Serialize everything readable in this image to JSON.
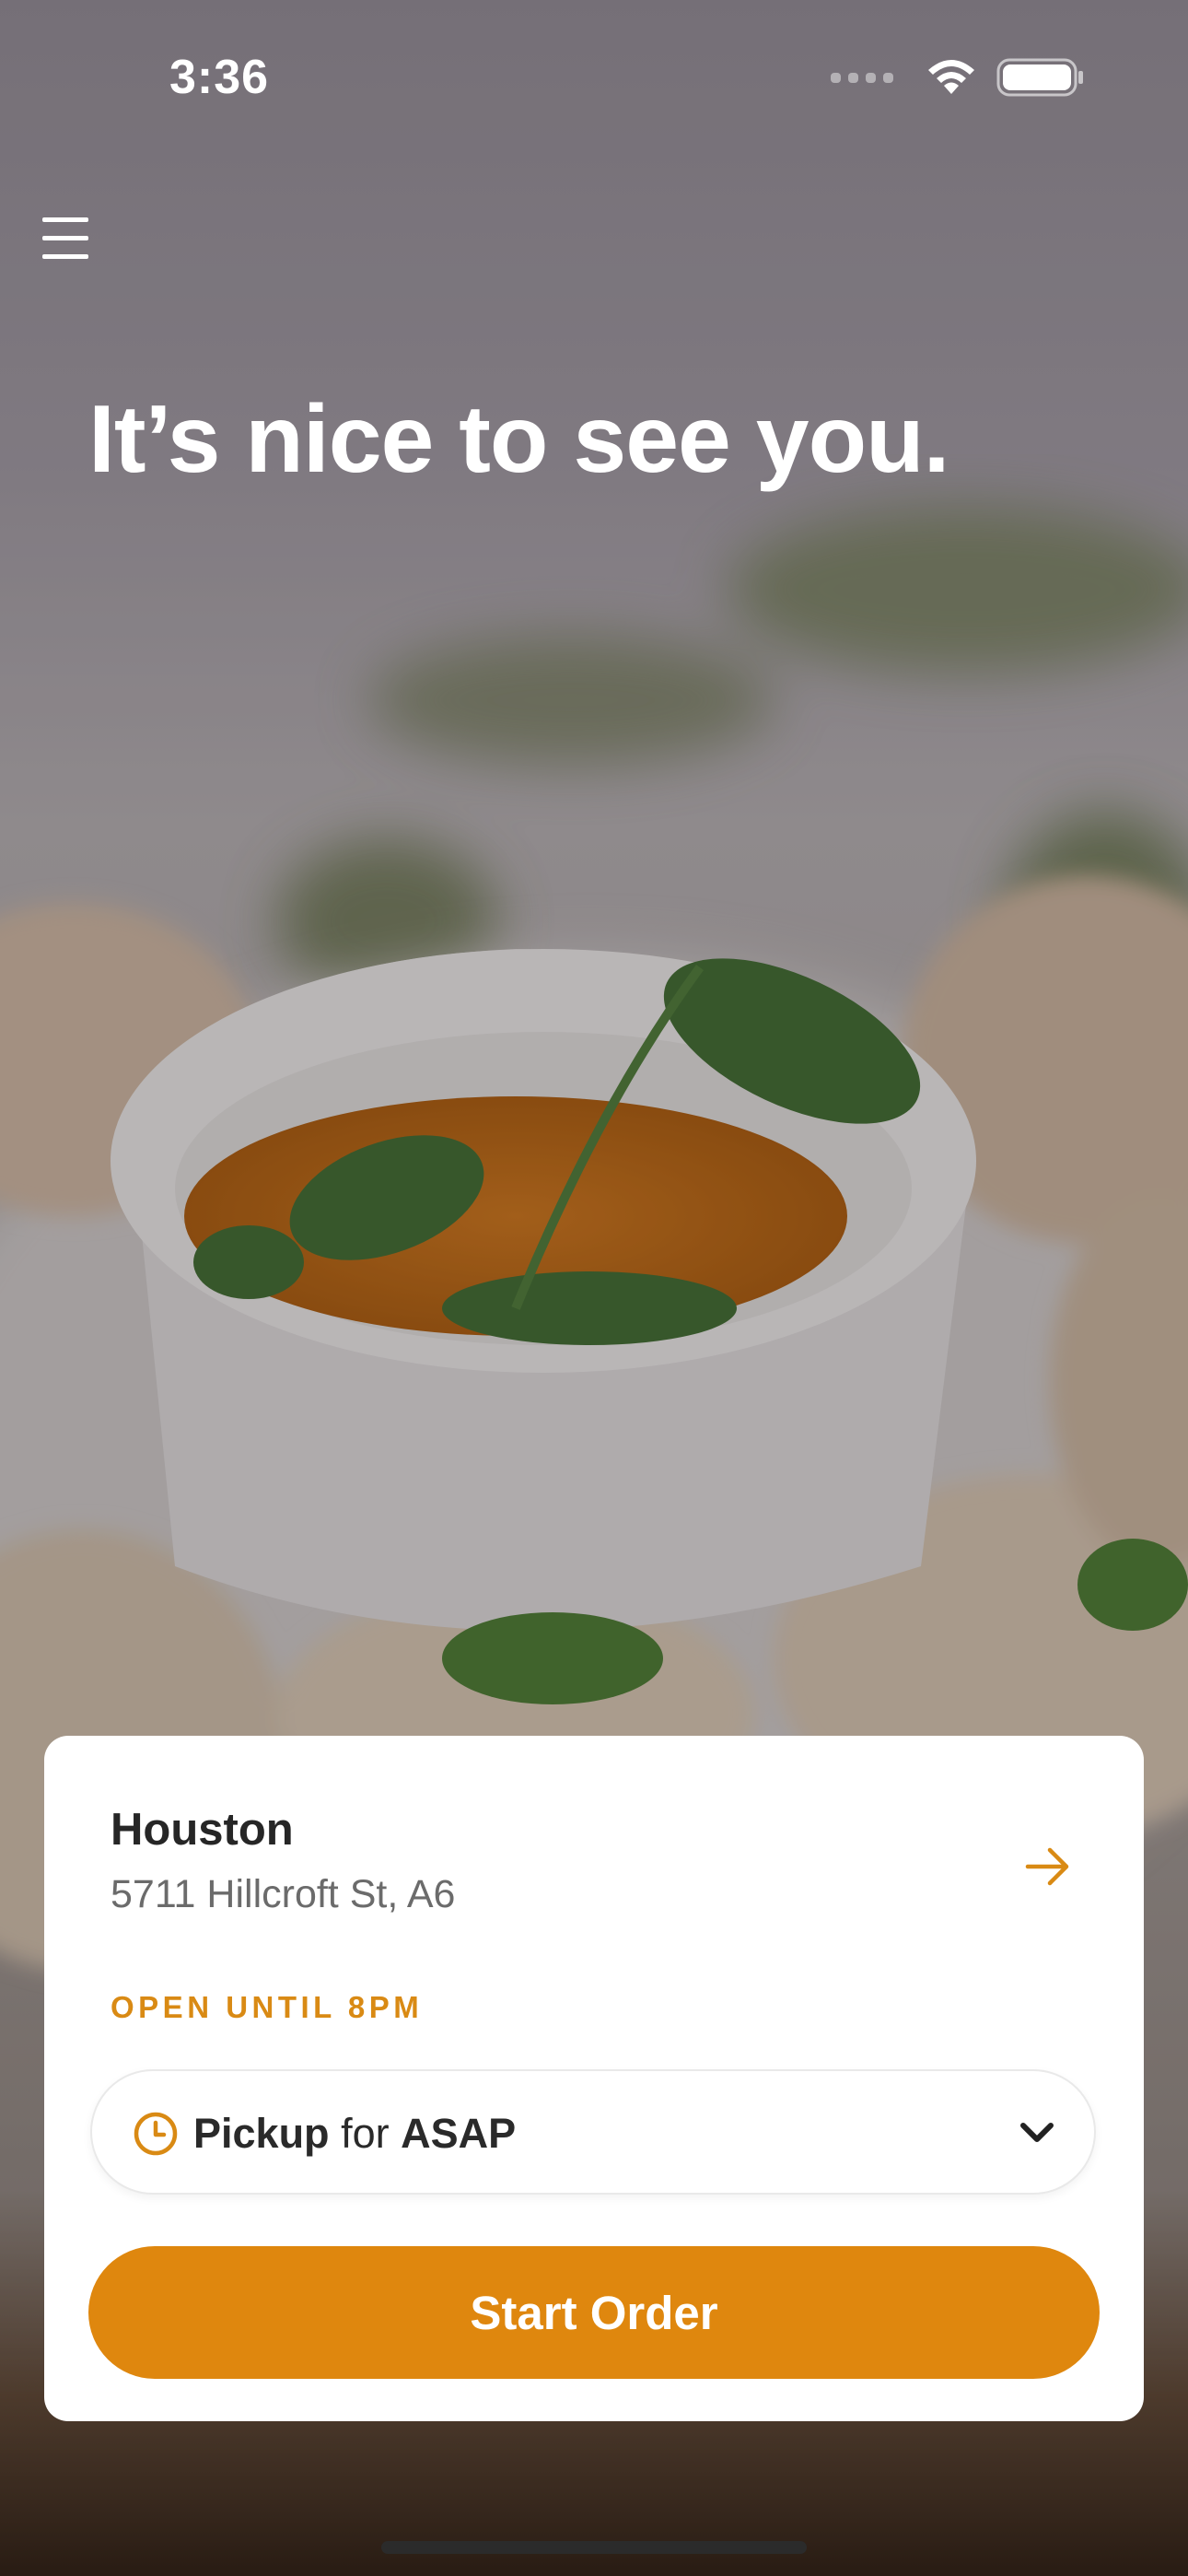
{
  "status_bar": {
    "time": "3:36",
    "icons": [
      "cellular-signal-icon",
      "wifi-icon",
      "battery-icon"
    ]
  },
  "header": {
    "menu_icon": "hamburger-menu-icon",
    "greeting": "It’s nice to see you."
  },
  "location_card": {
    "city": "Houston",
    "address": "5711 Hillcroft St, A6",
    "open_status": "OPEN UNTIL 8PM",
    "arrow_icon": "arrow-right-icon"
  },
  "order_options": {
    "mode": "Pickup",
    "connector": "for",
    "time": "ASAP",
    "clock_icon": "clock-icon",
    "dropdown_icon": "chevron-down-icon"
  },
  "actions": {
    "start_order_label": "Start Order"
  },
  "colors": {
    "accent": "#DF870E",
    "card_background": "#FFFFFF",
    "city_text": "#262626",
    "address_text": "#6B6B6B"
  }
}
